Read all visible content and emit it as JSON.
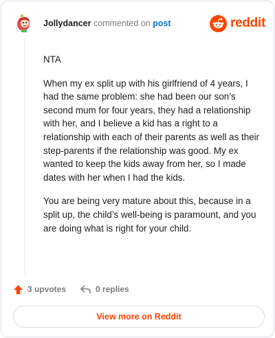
{
  "comment": {
    "author": "Jollydancer",
    "action_text": "commented on",
    "target_text": "post",
    "paragraphs": [
      "NTA",
      "When my ex split up with his girlfriend of 4 years, I had the same problem: she had been our son’s second mum for four years, they had a relationship with her, and I believe a kid has a right to a relationship with each of their parents as well as their step-parents if the relationship was good. My ex wanted to keep the kids away from her, so I made dates with her when I had the kids.",
      "You are being very mature about this, because in a split up, the child’s well-being is paramount, and you are doing what is right for your child."
    ],
    "upvotes": "3 upvotes",
    "replies": "0 replies"
  },
  "brand": {
    "name": "reddit",
    "logo_icon": "reddit-snoo-icon",
    "color": "#ff4500"
  },
  "footer": {
    "view_more_label": "View more on Reddit"
  },
  "colors": {
    "accent": "#ff4500",
    "link": "#0079d3",
    "muted": "#7c7c7c"
  }
}
